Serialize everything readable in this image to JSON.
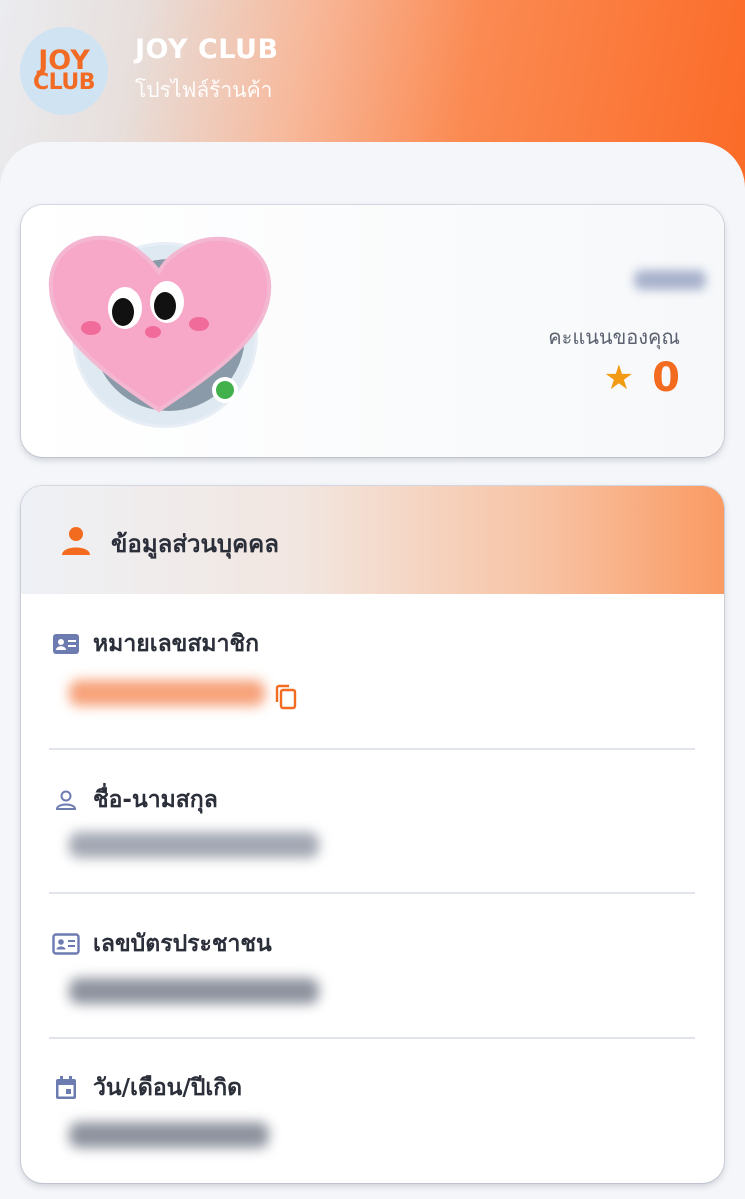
{
  "app": {
    "logo_line1": "JOY",
    "logo_line2": "CLUB",
    "title": "JOY CLUB",
    "subtitle": "โปรไฟล์ร้านค้า"
  },
  "profile": {
    "points_label": "คะแนนของคุณ",
    "points_value": "0",
    "star_icon": "star-icon",
    "online": true
  },
  "personal_info": {
    "title": "ข้อมูลส่วนบุคคล",
    "fields": [
      {
        "label": "หมายเลขสมาชิก",
        "icon": "id-card-icon",
        "copyable": true
      },
      {
        "label": "ชื่อ-นามสกุล",
        "icon": "person-outline-icon"
      },
      {
        "label": "เลขบัตรประชาชน",
        "icon": "id-card-icon"
      },
      {
        "label": "วัน/เดือน/ปีเกิด",
        "icon": "calendar-icon"
      }
    ]
  },
  "colors": {
    "accent": "#f26b1f",
    "star": "#f29a12",
    "online": "#43b14b",
    "icon_muted": "#6c7bb0"
  }
}
